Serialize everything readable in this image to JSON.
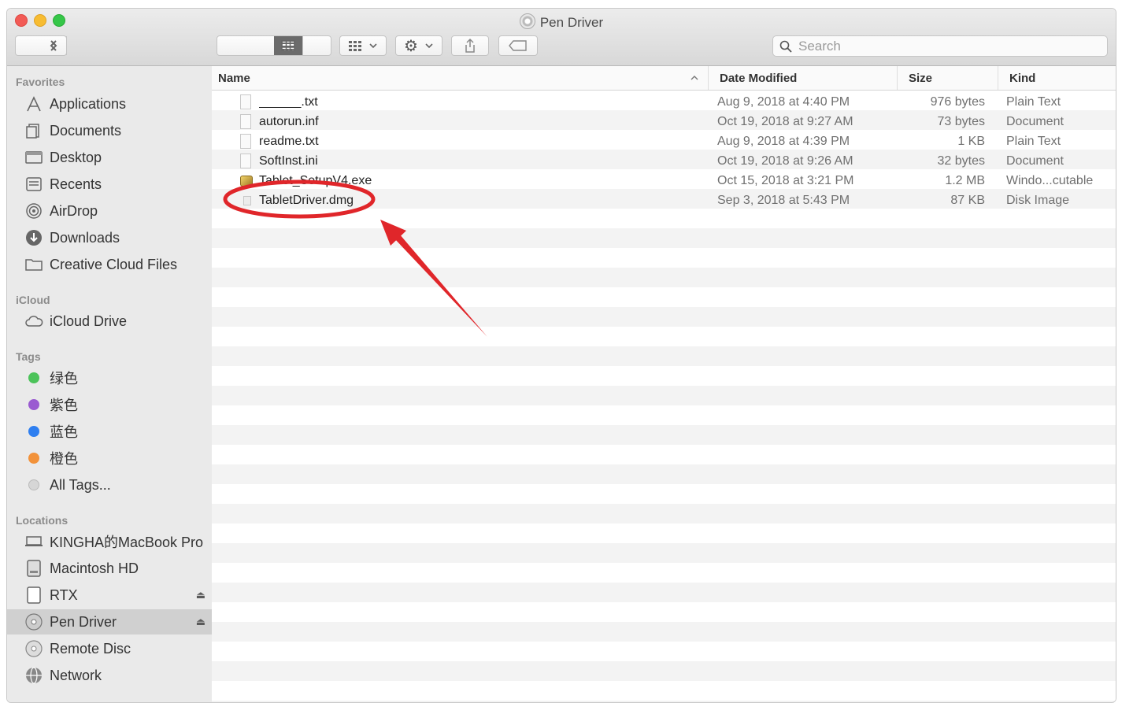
{
  "window": {
    "title": "Pen Driver"
  },
  "toolbar": {
    "back_icon": "chevron-left-icon",
    "forward_icon": "chevron-right-icon",
    "search_placeholder": "Search"
  },
  "sidebar": {
    "favorites_header": "Favorites",
    "favorites": [
      {
        "label": "Applications",
        "icon": "applications-icon"
      },
      {
        "label": "Documents",
        "icon": "documents-icon"
      },
      {
        "label": "Desktop",
        "icon": "desktop-icon"
      },
      {
        "label": "Recents",
        "icon": "recents-icon"
      },
      {
        "label": "AirDrop",
        "icon": "airdrop-icon"
      },
      {
        "label": "Downloads",
        "icon": "downloads-icon"
      },
      {
        "label": "Creative Cloud Files",
        "icon": "folder-icon"
      }
    ],
    "icloud_header": "iCloud",
    "icloud": [
      {
        "label": "iCloud Drive",
        "icon": "cloud-icon"
      }
    ],
    "tags_header": "Tags",
    "tags": [
      {
        "label": "绿色",
        "color": "#4cc35a"
      },
      {
        "label": "紫色",
        "color": "#9a5bd1"
      },
      {
        "label": "蓝色",
        "color": "#2f7ff0"
      },
      {
        "label": "橙色",
        "color": "#f2923a"
      },
      {
        "label": "All Tags...",
        "color": "#d6d6d6"
      }
    ],
    "locations_header": "Locations",
    "locations": [
      {
        "label": "KINGHA的MacBook Pro",
        "icon": "laptop-icon"
      },
      {
        "label": "Macintosh HD",
        "icon": "hard-drive-icon"
      },
      {
        "label": "RTX",
        "icon": "external-drive-icon",
        "eject": true
      },
      {
        "label": "Pen Driver",
        "icon": "disc-icon",
        "eject": true,
        "selected": true
      },
      {
        "label": "Remote Disc",
        "icon": "disc-icon"
      },
      {
        "label": "Network",
        "icon": "network-icon"
      }
    ]
  },
  "columns": {
    "name": "Name",
    "date": "Date Modified",
    "size": "Size",
    "kind": "Kind"
  },
  "files": [
    {
      "name": "______.txt",
      "date": "Aug 9, 2018 at 4:40 PM",
      "size": "976 bytes",
      "kind": "Plain Text",
      "icon": "text-file-icon"
    },
    {
      "name": "autorun.inf",
      "date": "Oct 19, 2018 at 9:27 AM",
      "size": "73 bytes",
      "kind": "Document",
      "icon": "document-icon"
    },
    {
      "name": "readme.txt",
      "date": "Aug 9, 2018 at 4:39 PM",
      "size": "1 KB",
      "kind": "Plain Text",
      "icon": "text-file-icon"
    },
    {
      "name": "SoftInst.ini",
      "date": "Oct 19, 2018 at 9:26 AM",
      "size": "32 bytes",
      "kind": "Document",
      "icon": "document-icon"
    },
    {
      "name": "Tablet_SetupV4.exe",
      "date": "Oct 15, 2018 at 3:21 PM",
      "size": "1.2 MB",
      "kind": "Windo...cutable",
      "icon": "exe-icon"
    },
    {
      "name": "TabletDriver.dmg",
      "date": "Sep 3, 2018 at 5:43 PM",
      "size": "87 KB",
      "kind": "Disk Image",
      "icon": "disk-image-icon"
    }
  ],
  "annotation": {
    "color": "#e0262a",
    "highlighted_file": "TabletDriver.dmg"
  }
}
